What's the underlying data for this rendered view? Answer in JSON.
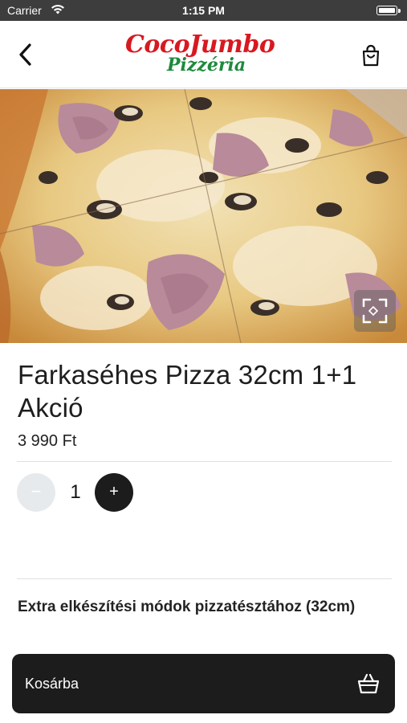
{
  "status_bar": {
    "carrier": "Carrier",
    "time": "1:15 PM"
  },
  "header": {
    "logo_line1": "CocoJumbo",
    "logo_line2": "Pizzéria"
  },
  "product": {
    "title": "Farkaséhes Pizza 32cm 1+1 Akció",
    "price": "3 990 Ft",
    "quantity": "1",
    "minus_label": "−",
    "plus_label": "+"
  },
  "options": {
    "section_title": "Extra elkészítési módok pizzatésztához (32cm)"
  },
  "cart_button": {
    "label": "Kosárba"
  },
  "colors": {
    "accent_dark": "#1c1c1c",
    "logo_red": "#d71920",
    "logo_green": "#1d8a3c",
    "minus_bg": "#e7eaec"
  },
  "icons": [
    "back-chevron-icon",
    "shopping-bag-icon",
    "expand-image-icon",
    "basket-icon",
    "wifi-icon",
    "battery-icon"
  ]
}
